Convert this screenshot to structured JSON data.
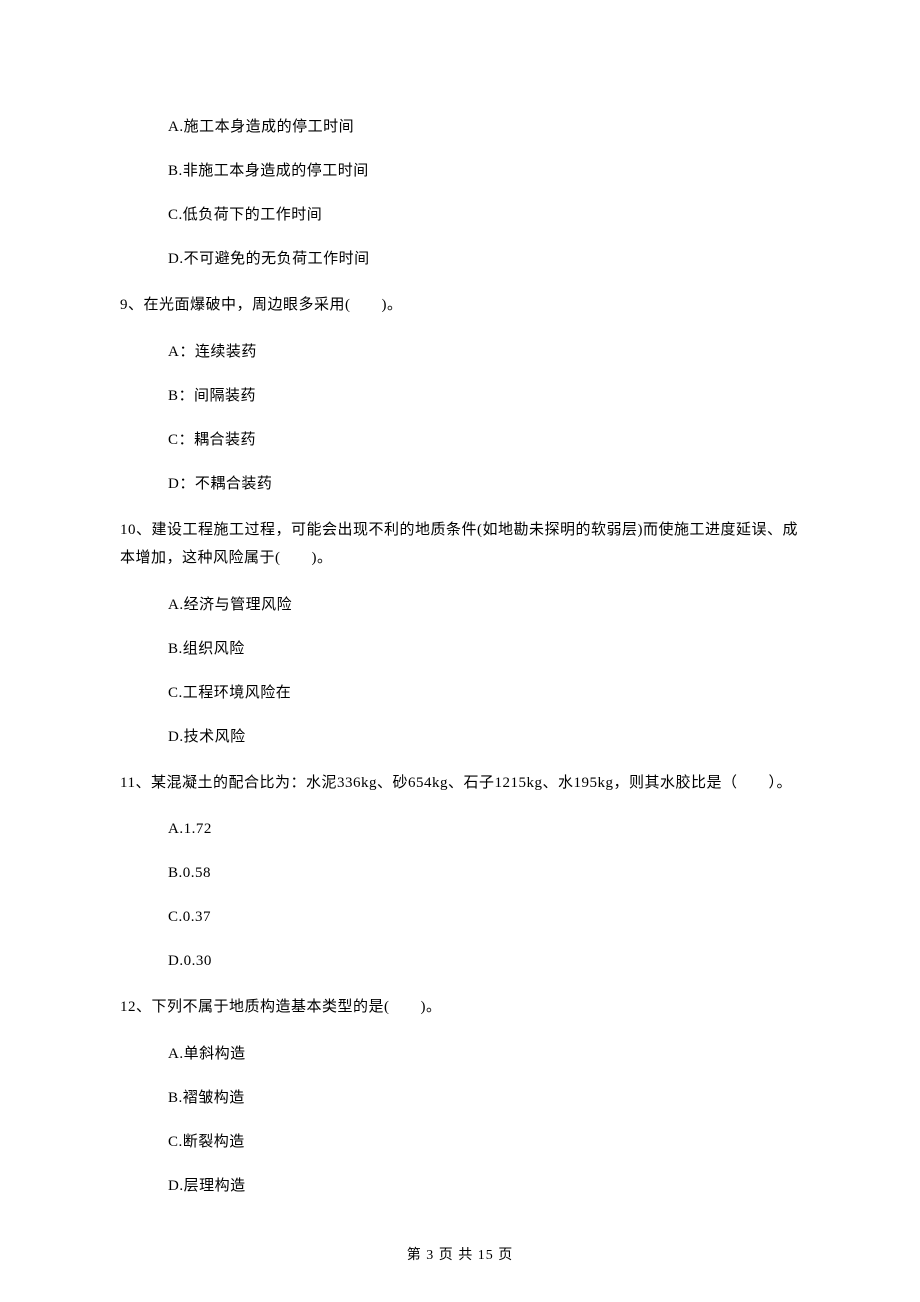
{
  "q8": {
    "options": {
      "a": "A.施工本身造成的停工时间",
      "b": "B.非施工本身造成的停工时间",
      "c": "C.低负荷下的工作时间",
      "d": "D.不可避免的无负荷工作时间"
    }
  },
  "q9": {
    "stem": "9、在光面爆破中，周边眼多采用(　　)。",
    "options": {
      "a": "A：连续装药",
      "b": "B：间隔装药",
      "c": "C：耦合装药",
      "d": "D：不耦合装药"
    }
  },
  "q10": {
    "stem": "10、建设工程施工过程，可能会出现不利的地质条件(如地勘未探明的软弱层)而使施工进度延误、成本增加，这种风险属于(　　)。",
    "options": {
      "a": "A.经济与管理风险",
      "b": "B.组织风险",
      "c": "C.工程环境风险在",
      "d": "D.技术风险"
    }
  },
  "q11": {
    "stem": "11、某混凝土的配合比为：水泥336kg、砂654kg、石子1215kg、水195kg，则其水胶比是（　　）。",
    "options": {
      "a": "A.1.72",
      "b": "B.0.58",
      "c": "C.0.37",
      "d": "D.0.30"
    }
  },
  "q12": {
    "stem": "12、下列不属于地质构造基本类型的是(　　)。",
    "options": {
      "a": "A.单斜构造",
      "b": "B.褶皱构造",
      "c": "C.断裂构造",
      "d": "D.层理构造"
    }
  },
  "footer": "第 3 页 共 15 页"
}
